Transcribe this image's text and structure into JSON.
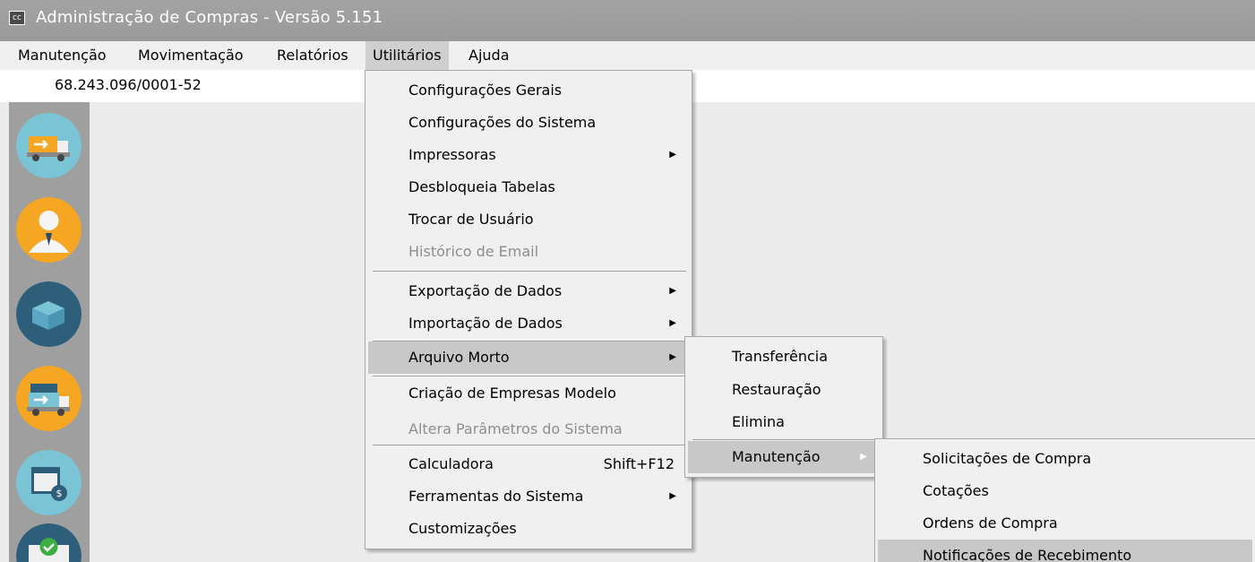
{
  "window": {
    "title": "Administração de Compras - Versão 5.151",
    "icon_label": "cc"
  },
  "menubar": {
    "items": [
      "Manutenção",
      "Movimentação",
      "Relatórios",
      "Utilitários",
      "Ajuda"
    ],
    "active": "Utilitários"
  },
  "company": {
    "cnpj": "68.243.096/0001-52"
  },
  "sidebar": {
    "icons": [
      "truck-icon",
      "user-icon",
      "box-icon",
      "truck-box-icon",
      "calendar-money-icon",
      "check-box-icon"
    ]
  },
  "utilitarios_menu": {
    "items": [
      {
        "label": "Configurações Gerais"
      },
      {
        "label": "Configurações do Sistema"
      },
      {
        "label": "Impressoras",
        "submenu": true
      },
      {
        "label": "Desbloqueia Tabelas"
      },
      {
        "label": "Trocar de Usuário"
      },
      {
        "label": "Histórico de Email",
        "disabled": true
      },
      {
        "label": "Exportação de Dados",
        "submenu": true
      },
      {
        "label": "Importação de Dados",
        "submenu": true
      },
      {
        "label": "Arquivo Morto",
        "submenu": true,
        "selected": true
      },
      {
        "label": "Criação de Empresas Modelo"
      },
      {
        "label": "Altera Parâmetros do Sistema",
        "disabled": true
      },
      {
        "label": "Calculadora",
        "shortcut": "Shift+F12"
      },
      {
        "label": "Ferramentas do Sistema",
        "submenu": true
      },
      {
        "label": "Customizações"
      }
    ]
  },
  "arquivo_morto_menu": {
    "items": [
      {
        "label": "Transferência"
      },
      {
        "label": "Restauração"
      },
      {
        "label": "Elimina"
      },
      {
        "label": "Manutenção",
        "submenu": true,
        "selected": true
      }
    ]
  },
  "manutencao_menu": {
    "items": [
      {
        "label": "Solicitações de Compra"
      },
      {
        "label": "Cotações"
      },
      {
        "label": "Ordens de Compra"
      },
      {
        "label": "Notificações de Recebimento",
        "selected": true
      }
    ]
  },
  "colors": {
    "titlebar": "#9f9f9f",
    "menu_bg": "#f0f0f0",
    "selected_bg": "#c8c8c8",
    "sidebar": "#9f9f9f"
  }
}
